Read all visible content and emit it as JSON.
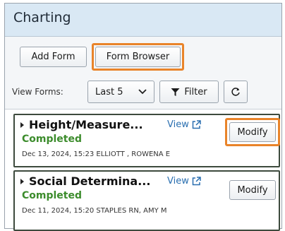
{
  "header": {
    "title": "Charting"
  },
  "toolbar": {
    "add_form": "Add Form",
    "form_browser": "Form Browser",
    "view_forms_label": "View Forms:",
    "last_select": "Last 5",
    "filter": "Filter",
    "refresh_icon": "refresh-icon"
  },
  "forms": [
    {
      "title": "Height/Measure...",
      "view_label": "View",
      "status": "Completed",
      "meta": "Dec 13, 2024, 15:23  ELLIOTT , ROWENA E",
      "modify_label": "Modify"
    },
    {
      "title": "Social Determina...",
      "view_label": "View",
      "status": "Completed",
      "meta": "Dec 11, 2024, 15:20  STAPLES RN, AMY M",
      "modify_label": "Modify"
    }
  ],
  "colors": {
    "highlight": "#e9842a",
    "status_completed": "#3c8c2c",
    "link": "#2a6fb0",
    "title_bg": "#d9e8f4"
  }
}
